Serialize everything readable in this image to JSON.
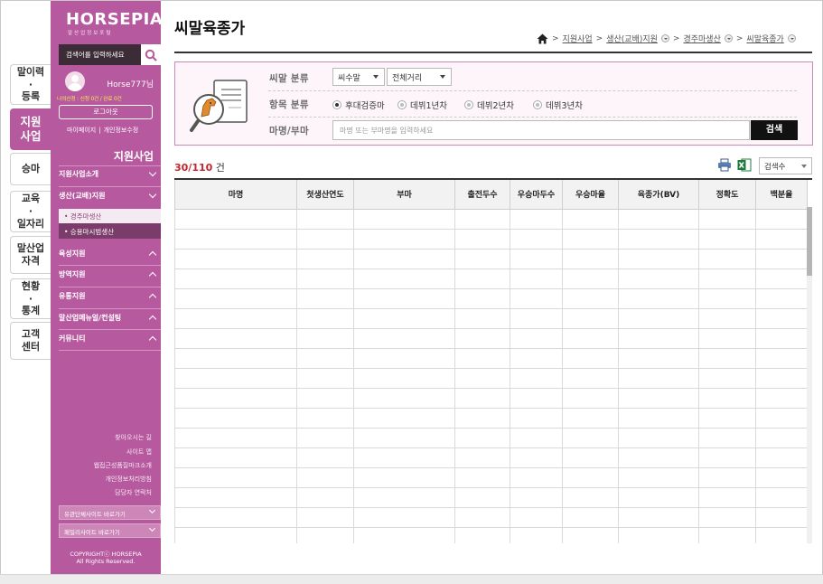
{
  "left_tabs": [
    {
      "label": "말이력\n·\n등록",
      "active": false
    },
    {
      "label": "지원\n사업",
      "active": true
    },
    {
      "label": "승마",
      "active": false
    },
    {
      "label": "교육\n·\n일자리",
      "active": false
    },
    {
      "label": "말산업\n자격",
      "active": false
    },
    {
      "label": "현황\n·\n통계",
      "active": false
    },
    {
      "label": "고객\n센터",
      "active": false
    }
  ],
  "sidebar": {
    "logo": "HORSEPIA",
    "logo_sub": "말산업정보포털",
    "search_placeholder": "검색어를 입력하세요",
    "username": "Horse777님",
    "user_stats": "나의신청 : 신청 0건 / 완료 0건",
    "logout": "로그아웃",
    "mypage": "마이페이지",
    "profile_edit": "개인정보수정",
    "title": "지원사업",
    "menu": [
      {
        "label": "지원사업소개",
        "expanded": false
      },
      {
        "label": "생산(교배)지원",
        "expanded": true
      },
      {
        "label": "육성지원",
        "expanded": false
      },
      {
        "label": "방역지원",
        "expanded": false
      },
      {
        "label": "유통지원",
        "expanded": false
      },
      {
        "label": "말산업메뉴얼/컨설팅",
        "expanded": false
      },
      {
        "label": "커뮤니티",
        "expanded": false
      }
    ],
    "submenu": [
      {
        "label": "• 경주마생산",
        "active": false
      },
      {
        "label": "• 승용마시범생산",
        "active": true
      }
    ],
    "footer_links": [
      "찾아오시는 길",
      "사이트 맵",
      "웹접근성품질마크소개",
      "개인정보처리방침",
      "담당자 연락처"
    ],
    "family_sites": [
      "유관단체사이트 바로가기",
      "패밀리사이트 바로가기"
    ],
    "copyright": "COPYRIGHTⓒ HORSEPIA",
    "rights": "All Rights Reserved."
  },
  "page": {
    "title": "씨말육종가",
    "breadcrumb": [
      "지원사업",
      "생산(교배)지원",
      "경주마생산",
      "씨말육종가"
    ]
  },
  "filter": {
    "label_horse_class": "씨말 분류",
    "horse_class_value": "씨수말",
    "distance_value": "전체거리",
    "label_item_class": "항목 분류",
    "radios": [
      {
        "label": "후대검증마",
        "checked": true
      },
      {
        "label": "데뷔1년차",
        "checked": false
      },
      {
        "label": "데뷔2년차",
        "checked": false
      },
      {
        "label": "데뷔3년차",
        "checked": false
      }
    ],
    "label_name": "마명/부마",
    "name_placeholder": "마명 또는 부마명을 입력하세요",
    "search_button": "검색"
  },
  "results": {
    "count": "30/110",
    "unit": "건",
    "sort_value": "검색수"
  },
  "table": {
    "columns": [
      "마명",
      "첫생산연도",
      "부마",
      "출전두수",
      "우승마두수",
      "우승마율",
      "육종가(BV)",
      "정확도",
      "백분율"
    ],
    "empty_rows": 17
  },
  "colors": {
    "brand": "#b6599f",
    "sidebar_dark": "#7c3c6b",
    "count_red": "#c0272d"
  }
}
